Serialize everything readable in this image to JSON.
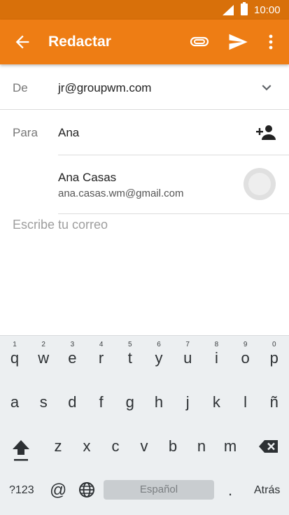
{
  "status_bar": {
    "time": "10:00"
  },
  "app_bar": {
    "title": "Redactar",
    "color": "#ee7d14",
    "back_icon": "arrow-left-icon",
    "attach_icon": "paperclip-icon",
    "send_icon": "send-icon",
    "more_icon": "more-vert-icon"
  },
  "from": {
    "label": "De",
    "value": "jr@groupwm.com"
  },
  "to": {
    "label": "Para",
    "value": "Ana"
  },
  "suggestion": {
    "name": "Ana Casas",
    "email": "ana.casas.wm@gmail.com"
  },
  "body": {
    "placeholder": "Escribe tu correo"
  },
  "keyboard": {
    "row1": [
      {
        "k": "q",
        "h": "1"
      },
      {
        "k": "w",
        "h": "2"
      },
      {
        "k": "e",
        "h": "3"
      },
      {
        "k": "r",
        "h": "4"
      },
      {
        "k": "t",
        "h": "5"
      },
      {
        "k": "y",
        "h": "6"
      },
      {
        "k": "u",
        "h": "7"
      },
      {
        "k": "i",
        "h": "8"
      },
      {
        "k": "o",
        "h": "9"
      },
      {
        "k": "p",
        "h": "0"
      }
    ],
    "row2": [
      "a",
      "s",
      "d",
      "f",
      "g",
      "h",
      "j",
      "k",
      "l",
      "ñ"
    ],
    "row3": [
      "z",
      "x",
      "c",
      "v",
      "b",
      "n",
      "m"
    ],
    "symbols": "?123",
    "at": "@",
    "space": "Español",
    "period": ".",
    "action": "Atrás"
  }
}
